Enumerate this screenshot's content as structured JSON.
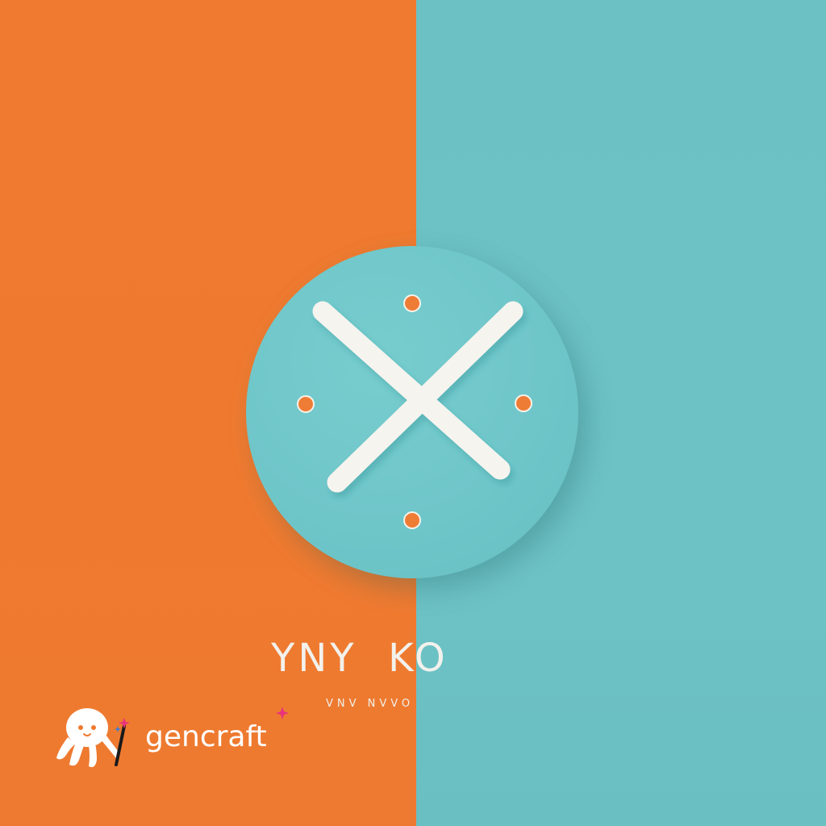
{
  "logo": {
    "wordmark": "YNY  KO",
    "tagline": "VNV NVVO",
    "icon": "x-mark-in-circle-icon",
    "colors": {
      "orange": "#f07a30",
      "teal": "#6cc1c4",
      "white": "#f6f4ef"
    }
  },
  "watermark": {
    "brand": "gencraft",
    "icon": "octopus-wand-icon"
  }
}
